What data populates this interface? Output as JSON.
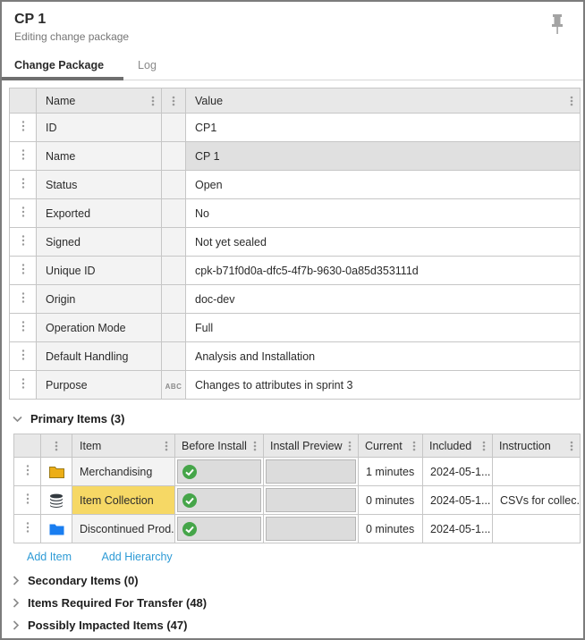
{
  "header": {
    "title": "CP 1",
    "subtitle": "Editing change package"
  },
  "tabs": [
    {
      "label": "Change Package",
      "active": true
    },
    {
      "label": "Log",
      "active": false
    }
  ],
  "properties_table": {
    "columns": {
      "name": "Name",
      "value": "Value"
    },
    "rows": [
      {
        "name": "ID",
        "value": "CP1"
      },
      {
        "name": "Name",
        "value": "CP 1",
        "selected": true
      },
      {
        "name": "Status",
        "value": "Open"
      },
      {
        "name": "Exported",
        "value": "No"
      },
      {
        "name": "Signed",
        "value": "Not yet sealed"
      },
      {
        "name": "Unique ID",
        "value": "cpk-b71f0d0a-dfc5-4f7b-9630-0a85d353111d"
      },
      {
        "name": "Origin",
        "value": "doc-dev"
      },
      {
        "name": "Operation Mode",
        "value": "Full"
      },
      {
        "name": "Default Handling",
        "value": "Analysis and Installation"
      },
      {
        "name": "Purpose",
        "value": "Changes to attributes in sprint 3",
        "type_badge": "ABC"
      }
    ]
  },
  "primary_items": {
    "title": "Primary Items (3)",
    "columns": [
      "Item",
      "Before Install",
      "Install Preview",
      "Current",
      "Included",
      "Instruction"
    ],
    "rows": [
      {
        "icon": "folder-amber",
        "item": "Merchandising",
        "before_install": "success",
        "current": "1 minutes",
        "included": "2024-05-1...",
        "instruction": "",
        "highlighted": false
      },
      {
        "icon": "database",
        "item": "Item Collection",
        "before_install": "success",
        "current": "0 minutes",
        "included": "2024-05-1...",
        "instruction": "CSVs for collec...",
        "highlighted": true
      },
      {
        "icon": "folder-blue",
        "item": "Discontinued Prod...",
        "before_install": "success",
        "current": "0 minutes",
        "included": "2024-05-1...",
        "instruction": "",
        "highlighted": false
      }
    ],
    "actions": [
      "Add Item",
      "Add Hierarchy"
    ]
  },
  "collapsed_sections": [
    "Secondary Items (0)",
    "Items Required For Transfer (48)",
    "Possibly Impacted Items (47)"
  ],
  "colors": {
    "link_blue": "#2e9bd6",
    "highlight_yellow": "#f6d865",
    "success_green": "#45a549",
    "folder_amber": "#ecae17",
    "folder_blue": "#1a7ef0"
  }
}
